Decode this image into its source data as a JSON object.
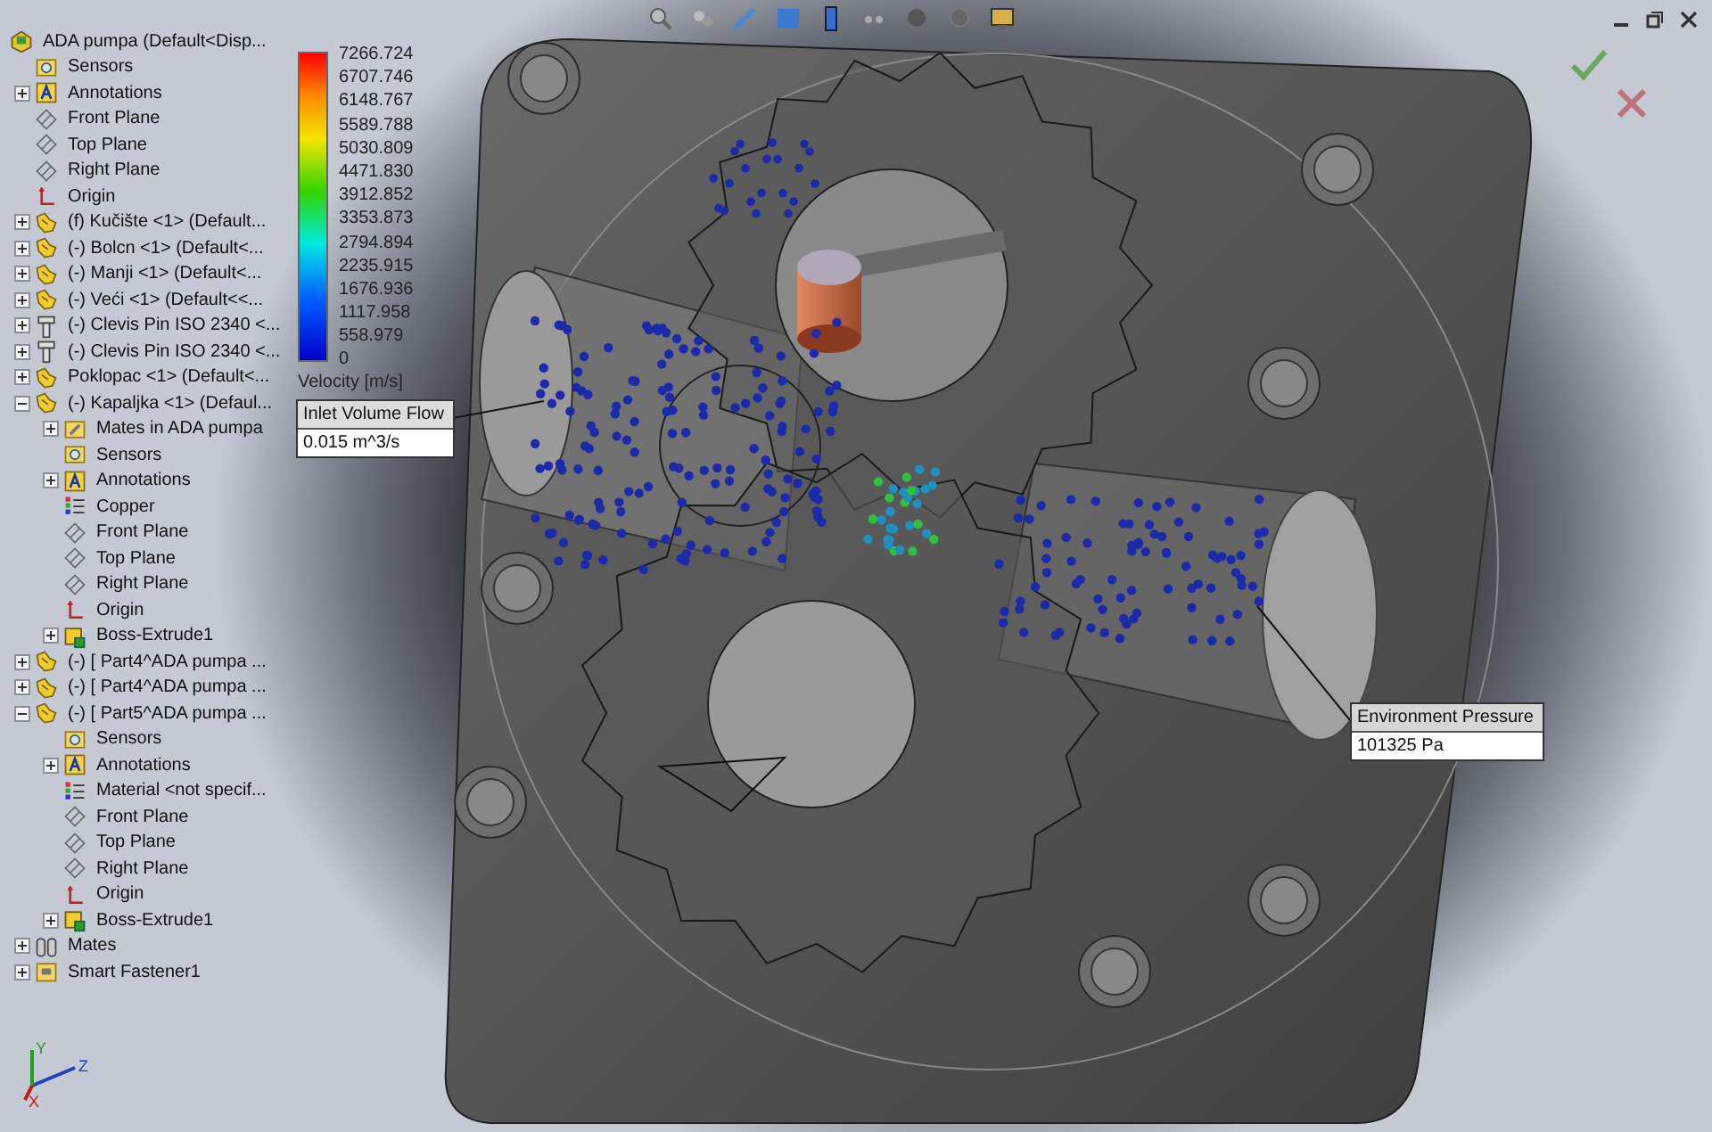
{
  "tree": {
    "label": "ADA pumpa  (Default<Disp...",
    "kind": "assembly",
    "children": [
      {
        "label": "Sensors",
        "kind": "sensors"
      },
      {
        "label": "Annotations",
        "kind": "annotations",
        "expanded": false
      },
      {
        "label": "Front Plane",
        "kind": "plane"
      },
      {
        "label": "Top Plane",
        "kind": "plane"
      },
      {
        "label": "Right Plane",
        "kind": "plane"
      },
      {
        "label": "Origin",
        "kind": "origin"
      },
      {
        "label": "(f) Kučište <1> (Default...",
        "kind": "part",
        "expanded": false
      },
      {
        "label": "(-) Bolcn <1> (Default<...",
        "kind": "part",
        "expanded": false
      },
      {
        "label": "(-) Manji <1> (Default<...",
        "kind": "part",
        "expanded": false
      },
      {
        "label": "(-) Veći <1> (Default<<...",
        "kind": "part",
        "expanded": false
      },
      {
        "label": "(-) Clevis Pin ISO 2340 <...",
        "kind": "pin",
        "expanded": false
      },
      {
        "label": "(-) Clevis Pin ISO 2340 <...",
        "kind": "pin",
        "expanded": false
      },
      {
        "label": "Poklopac <1> (Default<...",
        "kind": "part",
        "expanded": false
      },
      {
        "label": "(-) Kapaljka <1> (Defaul...",
        "kind": "part",
        "expanded": true,
        "children": [
          {
            "label": "Mates in ADA pumpa",
            "kind": "mates-folder",
            "expanded": false
          },
          {
            "label": "Sensors",
            "kind": "sensors"
          },
          {
            "label": "Annotations",
            "kind": "annotations",
            "expanded": false
          },
          {
            "label": "Copper",
            "kind": "material"
          },
          {
            "label": "Front Plane",
            "kind": "plane"
          },
          {
            "label": "Top Plane",
            "kind": "plane"
          },
          {
            "label": "Right Plane",
            "kind": "plane"
          },
          {
            "label": "Origin",
            "kind": "origin"
          },
          {
            "label": "Boss-Extrude1",
            "kind": "feature",
            "expanded": false
          }
        ]
      },
      {
        "label": "(-) [ Part4^ADA pumpa ...",
        "kind": "part",
        "expanded": false
      },
      {
        "label": "(-) [ Part4^ADA pumpa ...",
        "kind": "part",
        "expanded": false
      },
      {
        "label": "(-) [ Part5^ADA pumpa ...",
        "kind": "part",
        "expanded": true,
        "children": [
          {
            "label": "Sensors",
            "kind": "sensors"
          },
          {
            "label": "Annotations",
            "kind": "annotations",
            "expanded": false
          },
          {
            "label": "Material <not specif...",
            "kind": "material"
          },
          {
            "label": "Front Plane",
            "kind": "plane"
          },
          {
            "label": "Top Plane",
            "kind": "plane"
          },
          {
            "label": "Right Plane",
            "kind": "plane"
          },
          {
            "label": "Origin",
            "kind": "origin"
          },
          {
            "label": "Boss-Extrude1",
            "kind": "feature",
            "expanded": false
          }
        ]
      },
      {
        "label": "Mates",
        "kind": "mates",
        "expanded": false
      },
      {
        "label": "Smart Fastener1",
        "kind": "fastener",
        "expanded": false
      }
    ]
  },
  "legend": {
    "title": "Velocity [m/s]",
    "values": [
      "7266.724",
      "6707.746",
      "6148.767",
      "5589.788",
      "5030.809",
      "4471.830",
      "3912.852",
      "3353.873",
      "2794.894",
      "2235.915",
      "1676.936",
      "1117.958",
      "558.979",
      "0"
    ]
  },
  "callouts": [
    {
      "kind": "inlet",
      "title": "Inlet Volume Flow",
      "value": "0.015 m^3/s"
    },
    {
      "kind": "outlet",
      "title": "Environment Pressure",
      "value": "101325 Pa"
    }
  ],
  "triad": {
    "axes": [
      "Z",
      "Y",
      "X"
    ]
  }
}
